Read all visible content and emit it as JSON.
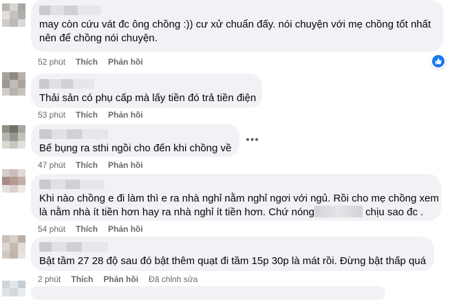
{
  "comments": [
    {
      "lines": [
        "may còn cứu vát đc ông chồng :)) cư xử chuẩn đấy. nói chuyện với mẹ chồng tốt nhất",
        "nên để chồng nói chuyện."
      ],
      "time": "52 phút",
      "like": "Thích",
      "reply": "Phản hồi"
    },
    {
      "lines": [
        "Thải sản có phụ cấp mà lấy tiền đó trả tiền điện"
      ],
      "time": "53 phút",
      "like": "Thích",
      "reply": "Phản hồi"
    },
    {
      "lines": [
        "Bế bụng ra sthi ngồi cho đến khi chồng về"
      ],
      "time": "47 phút",
      "like": "Thích",
      "reply": "Phản hồi"
    },
    {
      "lines": [
        "Khi nào chồng e đi làm thì e ra nhà nghỉ nằm nghỉ ngơi với ngủ. Rồi cho mẹ chồng xem",
        "là nằm nhà ít tiền hơn hay ra nhà nghỉ ít tiền hơn. Chứ nóng"
      ],
      "line2_tail": "chịu sao đc .",
      "time": "54 phút",
      "like": "Thích",
      "reply": "Phản hồi"
    },
    {
      "lines": [
        "Bật tầm 27 28 độ sau đó bật thêm quạt đi tầm 15p 30p là mát rồi. Đừng bật thấp quá"
      ],
      "time": "2 phút",
      "like": "Thích",
      "reply": "Phản hồi",
      "edited": "Đã chỉnh sửa"
    }
  ],
  "colors": {
    "bubble": "#f0f2f5",
    "meta": "#65676b",
    "like_accent": "#1877f2"
  }
}
